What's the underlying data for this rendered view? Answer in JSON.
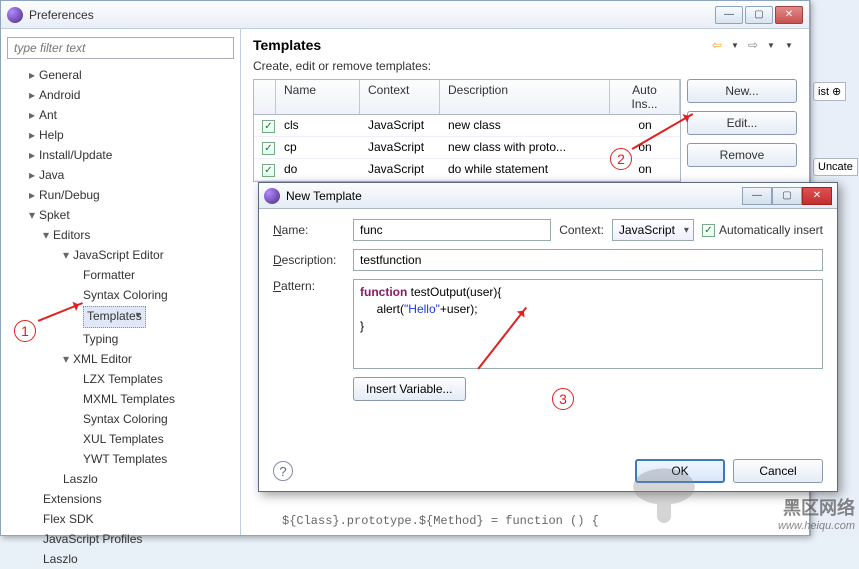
{
  "prefs": {
    "title": "Preferences",
    "filter_placeholder": "type filter text",
    "tree": {
      "general": "General",
      "android": "Android",
      "ant": "Ant",
      "help": "Help",
      "install": "Install/Update",
      "java": "Java",
      "rundebug": "Run/Debug",
      "spket": "Spket",
      "editors": "Editors",
      "js_editor": "JavaScript Editor",
      "formatter": "Formatter",
      "syntax_coloring": "Syntax Coloring",
      "templates": "Templates",
      "typing": "Typing",
      "xml_editor": "XML Editor",
      "lzx": "LZX Templates",
      "mxml": "MXML Templates",
      "syntax_coloring2": "Syntax Coloring",
      "xul": "XUL Templates",
      "ywt": "YWT Templates",
      "laszlo": "Laszlo",
      "extensions": "Extensions",
      "flex": "Flex SDK",
      "jsprofiles": "JavaScript Profiles",
      "laszlo2": "Laszlo"
    }
  },
  "templates_panel": {
    "heading": "Templates",
    "subtitle": "Create, edit or remove templates:",
    "cols": {
      "name": "Name",
      "context": "Context",
      "desc": "Description",
      "auto": "Auto Ins..."
    },
    "rows": [
      {
        "name": "cls",
        "context": "JavaScript",
        "desc": "new class",
        "auto": "on"
      },
      {
        "name": "cp",
        "context": "JavaScript",
        "desc": "new class with proto...",
        "auto": "on"
      },
      {
        "name": "do",
        "context": "JavaScript",
        "desc": "do while statement",
        "auto": "on"
      }
    ],
    "buttons": {
      "new": "New...",
      "edit": "Edit...",
      "remove": "Remove"
    }
  },
  "dlg": {
    "title": "New Template",
    "labels": {
      "name": "Name:",
      "context": "Context:",
      "auto": "Automatically insert",
      "desc": "Description:",
      "pattern": "Pattern:",
      "insert": "Insert Variable..."
    },
    "fields": {
      "name": "func",
      "context": "JavaScript",
      "desc": "testfunction",
      "pattern_kw": "function",
      "pattern_sig": " testOutput(user){",
      "pattern_body1": "     alert(",
      "pattern_str": "\"Hello\"",
      "pattern_body2": "+user);",
      "pattern_close": "}"
    },
    "buttons": {
      "ok": "OK",
      "cancel": "Cancel"
    }
  },
  "bg": {
    "code": "${Class}.prototype.${Method} = function () {"
  },
  "right_strip": {
    "tab1": "ist ⊕",
    "tab2": "Uncate"
  },
  "watermark": {
    "cn": "黑区网络",
    "url": "www.heiqu.com"
  },
  "annotations": {
    "n1": "1",
    "n2": "2",
    "n3": "3"
  }
}
